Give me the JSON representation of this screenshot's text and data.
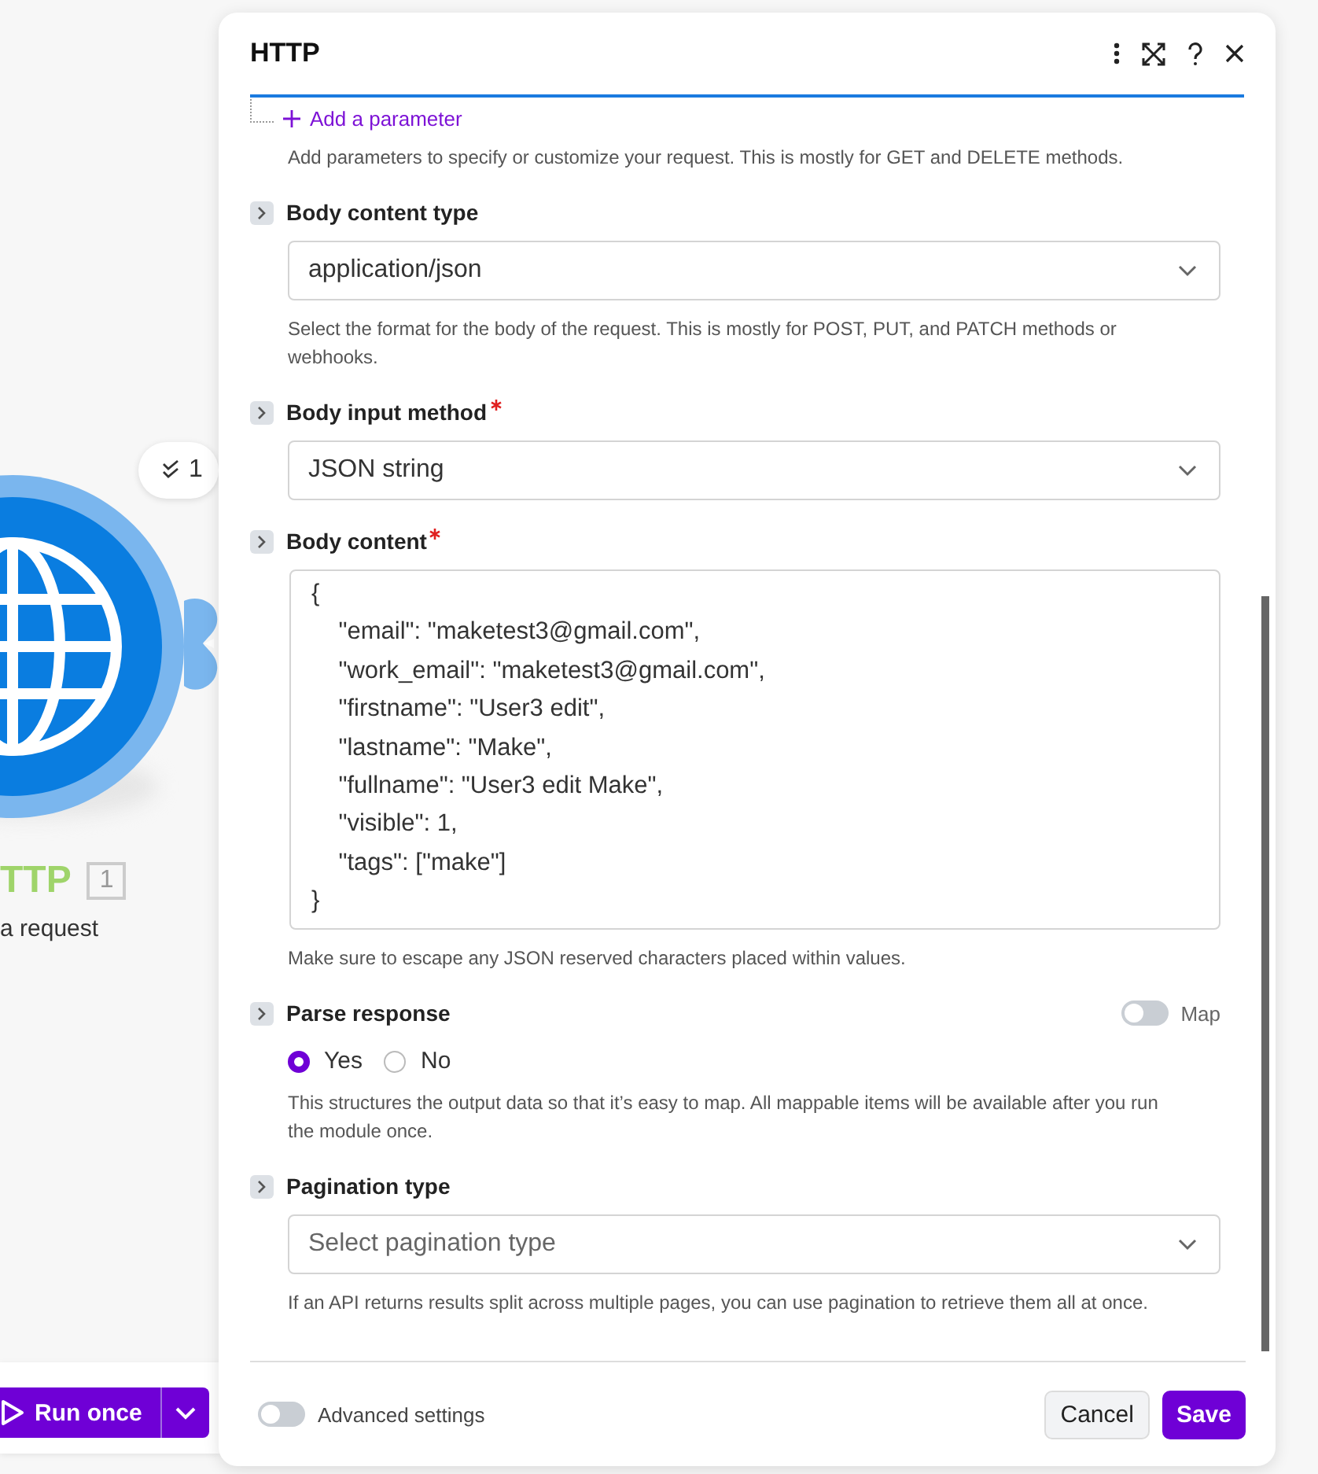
{
  "canvas": {
    "module": {
      "title": "TTP",
      "badge": "1",
      "subtitle": "a request",
      "operations": "1"
    },
    "run_button": {
      "label": "Run once"
    }
  },
  "dialog": {
    "title": "HTTP",
    "add_parameter": {
      "label": "Add a parameter",
      "hint": "Add parameters to specify or customize your request. This is mostly for GET and DELETE methods."
    },
    "fields": [
      {
        "kind": "select",
        "label": "Body content type",
        "required": false,
        "value": "application/json",
        "hint": "Select the format for the body of the request. This is mostly for POST, PUT, and PATCH methods or webhooks."
      },
      {
        "kind": "select",
        "label": "Body input method",
        "required": true,
        "value": "JSON string"
      },
      {
        "kind": "textarea",
        "label": "Body content",
        "required": true,
        "value": "{\n    \"email\": \"maketest3@gmail.com\",\n    \"work_email\": \"maketest3@gmail.com\",\n    \"firstname\": \"User3 edit\",\n    \"lastname\": \"Make\",\n    \"fullname\": \"User3 edit Make\",\n    \"visible\": 1,\n    \"tags\": [\"make\"]\n}",
        "hint": "Make sure to escape any JSON reserved characters placed within values."
      },
      {
        "kind": "radio",
        "label": "Parse response",
        "required": false,
        "map_toggle": {
          "label": "Map",
          "on": false
        },
        "options": [
          {
            "label": "Yes",
            "selected": true
          },
          {
            "label": "No",
            "selected": false
          }
        ],
        "hint": "This structures the output data so that it’s easy to map. All mappable items will be available after you run the module once."
      },
      {
        "kind": "select",
        "label": "Pagination type",
        "required": false,
        "placeholder": "Select pagination type",
        "hint": "If an API returns results split across multiple pages, you can use pagination to retrieve them all at once."
      }
    ],
    "footer": {
      "advanced_toggle": {
        "label": "Advanced settings",
        "on": false
      },
      "buttons": [
        {
          "label": "Cancel",
          "kind": "secondary"
        },
        {
          "label": "Save",
          "kind": "primary"
        }
      ]
    }
  }
}
